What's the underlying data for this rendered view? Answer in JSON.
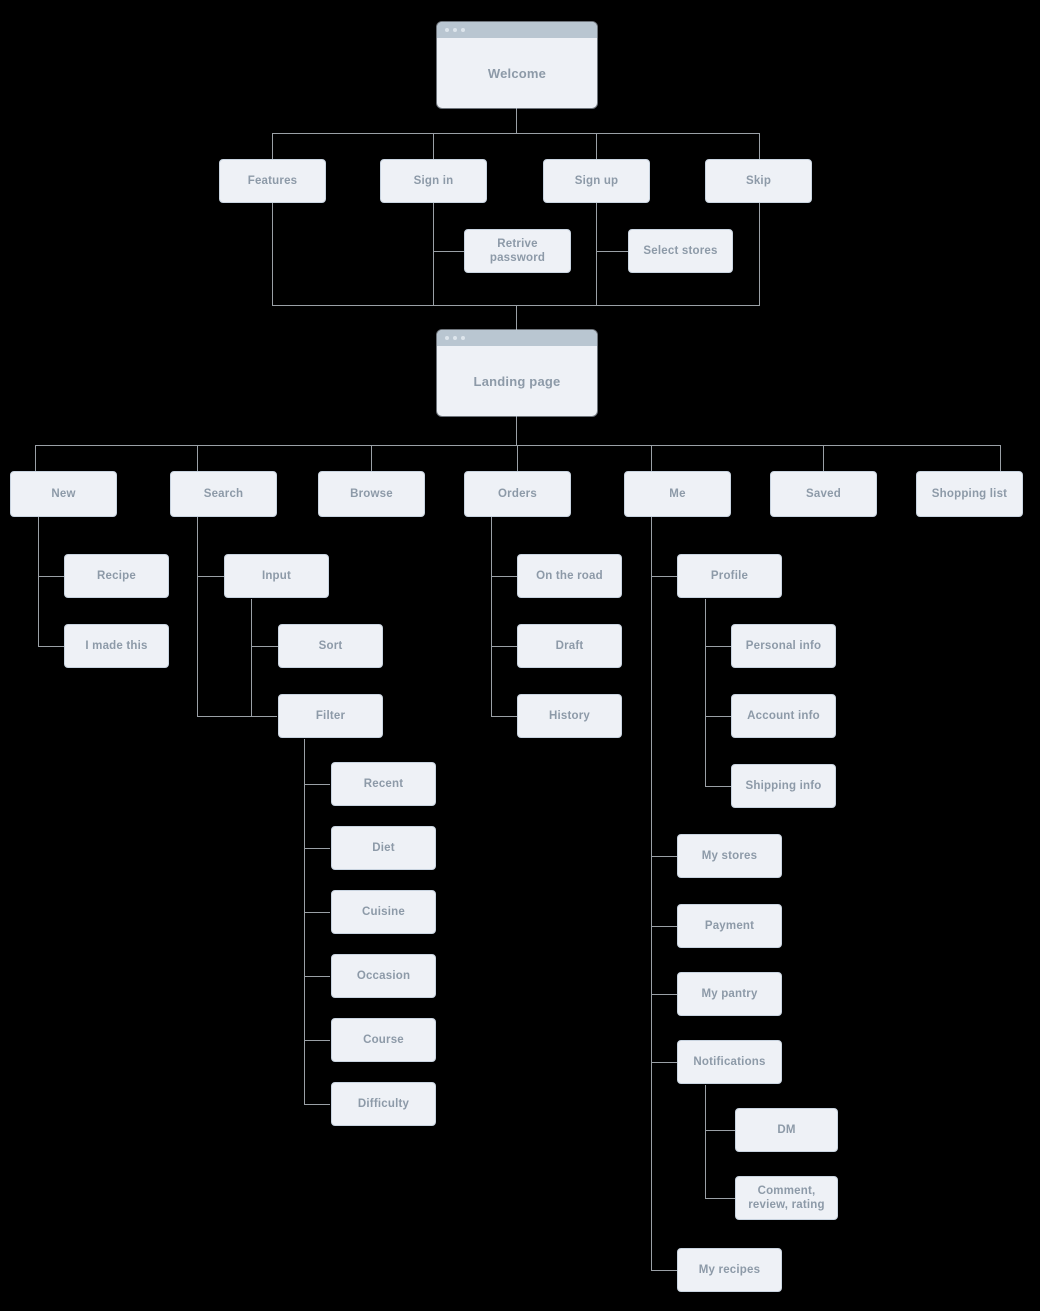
{
  "diagram": {
    "type": "sitemap-tree",
    "title": "",
    "colors": {
      "background": "#000000",
      "node_fill": "#eef1f6",
      "node_border": "#c9d4e0",
      "node_text": "#8d9aa8",
      "connector": "#9aa0a6",
      "window_titlebar": "#b9c6d1",
      "window_dot": "#dde5ec"
    },
    "nodes": {
      "welcome": {
        "label": "Welcome",
        "kind": "window"
      },
      "features": {
        "label": "Features",
        "kind": "box"
      },
      "sign_in": {
        "label": "Sign in",
        "kind": "box"
      },
      "sign_up": {
        "label": "Sign up",
        "kind": "box"
      },
      "skip": {
        "label": "Skip",
        "kind": "box"
      },
      "retrive_password": {
        "label": "Retrive password",
        "kind": "box"
      },
      "select_stores": {
        "label": "Select stores",
        "kind": "box"
      },
      "landing_page": {
        "label": "Landing page",
        "kind": "window"
      },
      "new": {
        "label": "New",
        "kind": "box"
      },
      "search": {
        "label": "Search",
        "kind": "box"
      },
      "browse": {
        "label": "Browse",
        "kind": "box"
      },
      "orders": {
        "label": "Orders",
        "kind": "box"
      },
      "me": {
        "label": "Me",
        "kind": "box"
      },
      "saved": {
        "label": "Saved",
        "kind": "box"
      },
      "shopping_list": {
        "label": "Shopping list",
        "kind": "box"
      },
      "recipe": {
        "label": "Recipe",
        "kind": "box"
      },
      "i_made_this": {
        "label": "I made this",
        "kind": "box"
      },
      "input": {
        "label": "Input",
        "kind": "box"
      },
      "sort": {
        "label": "Sort",
        "kind": "box"
      },
      "filter": {
        "label": "Filter",
        "kind": "box"
      },
      "recent": {
        "label": "Recent",
        "kind": "box"
      },
      "diet": {
        "label": "Diet",
        "kind": "box"
      },
      "cuisine": {
        "label": "Cuisine",
        "kind": "box"
      },
      "occasion": {
        "label": "Occasion",
        "kind": "box"
      },
      "course": {
        "label": "Course",
        "kind": "box"
      },
      "difficulty": {
        "label": "Difficulty",
        "kind": "box"
      },
      "on_the_road": {
        "label": "On the road",
        "kind": "box"
      },
      "draft": {
        "label": "Draft",
        "kind": "box"
      },
      "history": {
        "label": "History",
        "kind": "box"
      },
      "profile": {
        "label": "Profile",
        "kind": "box"
      },
      "personal_info": {
        "label": "Personal info",
        "kind": "box"
      },
      "account_info": {
        "label": "Account info",
        "kind": "box"
      },
      "shipping_info": {
        "label": "Shipping info",
        "kind": "box"
      },
      "my_stores": {
        "label": "My stores",
        "kind": "box"
      },
      "payment": {
        "label": "Payment",
        "kind": "box"
      },
      "my_pantry": {
        "label": "My pantry",
        "kind": "box"
      },
      "notifications": {
        "label": "Notifications",
        "kind": "box"
      },
      "dm": {
        "label": "DM",
        "kind": "box"
      },
      "comment_review_rating": {
        "label": "Comment, review, rating",
        "kind": "box"
      },
      "my_recipes": {
        "label": "My recipes",
        "kind": "box"
      }
    },
    "edges": [
      [
        "welcome",
        "features"
      ],
      [
        "welcome",
        "sign_in"
      ],
      [
        "welcome",
        "sign_up"
      ],
      [
        "welcome",
        "skip"
      ],
      [
        "sign_in",
        "retrive_password"
      ],
      [
        "sign_up",
        "select_stores"
      ],
      [
        "features",
        "landing_page"
      ],
      [
        "sign_in",
        "landing_page"
      ],
      [
        "sign_up",
        "landing_page"
      ],
      [
        "skip",
        "landing_page"
      ],
      [
        "landing_page",
        "new"
      ],
      [
        "landing_page",
        "search"
      ],
      [
        "landing_page",
        "browse"
      ],
      [
        "landing_page",
        "orders"
      ],
      [
        "landing_page",
        "me"
      ],
      [
        "landing_page",
        "saved"
      ],
      [
        "landing_page",
        "shopping_list"
      ],
      [
        "new",
        "recipe"
      ],
      [
        "new",
        "i_made_this"
      ],
      [
        "search",
        "input"
      ],
      [
        "search",
        "filter"
      ],
      [
        "input",
        "sort"
      ],
      [
        "input",
        "filter"
      ],
      [
        "filter",
        "recent"
      ],
      [
        "filter",
        "diet"
      ],
      [
        "filter",
        "cuisine"
      ],
      [
        "filter",
        "occasion"
      ],
      [
        "filter",
        "course"
      ],
      [
        "filter",
        "difficulty"
      ],
      [
        "orders",
        "on_the_road"
      ],
      [
        "orders",
        "draft"
      ],
      [
        "orders",
        "history"
      ],
      [
        "me",
        "profile"
      ],
      [
        "profile",
        "personal_info"
      ],
      [
        "profile",
        "account_info"
      ],
      [
        "profile",
        "shipping_info"
      ],
      [
        "me",
        "my_stores"
      ],
      [
        "me",
        "payment"
      ],
      [
        "me",
        "my_pantry"
      ],
      [
        "me",
        "notifications"
      ],
      [
        "notifications",
        "dm"
      ],
      [
        "notifications",
        "comment_review_rating"
      ],
      [
        "me",
        "my_recipes"
      ]
    ]
  }
}
